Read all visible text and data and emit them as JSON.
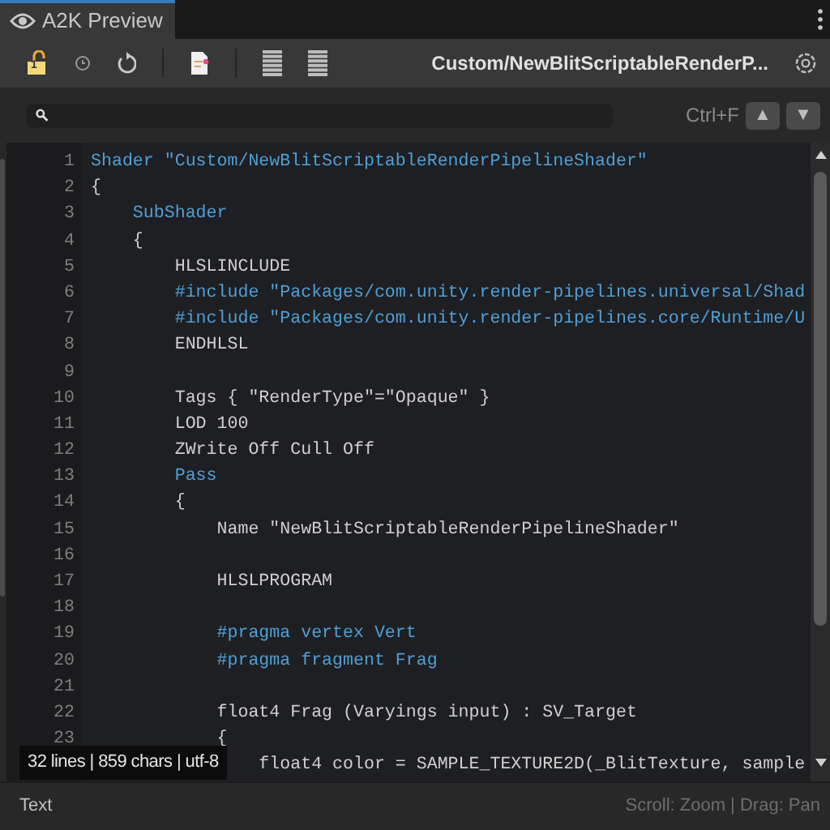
{
  "tab": {
    "label": "A2K Preview",
    "selected": true
  },
  "toolbar": {
    "lock_badge": "1",
    "title": "Custom/NewBlitScriptableRenderP..."
  },
  "search": {
    "shortcut": "Ctrl+F",
    "prev": "▲",
    "next": "▼"
  },
  "code": {
    "lines": [
      {
        "number": "1",
        "kind": "keyword",
        "text": "Shader \"Custom/NewBlitScriptableRenderPipelineShader\""
      },
      {
        "number": "2",
        "kind": "plain",
        "text": "{"
      },
      {
        "number": "3",
        "kind": "keyword",
        "text": "    SubShader"
      },
      {
        "number": "4",
        "kind": "plain",
        "text": "    {"
      },
      {
        "number": "5",
        "kind": "plain",
        "text": "        HLSLINCLUDE"
      },
      {
        "number": "6",
        "kind": "keyword",
        "text": "        #include \"Packages/com.unity.render-pipelines.universal/Shad"
      },
      {
        "number": "7",
        "kind": "keyword",
        "text": "        #include \"Packages/com.unity.render-pipelines.core/Runtime/U"
      },
      {
        "number": "8",
        "kind": "plain",
        "text": "        ENDHLSL"
      },
      {
        "number": "9",
        "kind": "plain"
      },
      {
        "number": "10",
        "kind": "plain",
        "text": "        Tags { \"RenderType\"=\"Opaque\" }"
      },
      {
        "number": "11",
        "kind": "plain",
        "text": "        LOD 100"
      },
      {
        "number": "12",
        "kind": "plain",
        "text": "        ZWrite Off Cull Off"
      },
      {
        "number": "13",
        "kind": "keyword",
        "text": "        Pass"
      },
      {
        "number": "14",
        "kind": "plain",
        "text": "        {"
      },
      {
        "number": "15",
        "kind": "plain",
        "text": "            Name \"NewBlitScriptableRenderPipelineShader\""
      },
      {
        "number": "16",
        "kind": "plain"
      },
      {
        "number": "17",
        "kind": "plain",
        "text": "            HLSLPROGRAM"
      },
      {
        "number": "18",
        "kind": "plain"
      },
      {
        "number": "19",
        "kind": "keyword",
        "text": "            #pragma vertex Vert"
      },
      {
        "number": "20",
        "kind": "keyword",
        "text": "            #pragma fragment Frag"
      },
      {
        "number": "21",
        "kind": "plain"
      },
      {
        "number": "22",
        "kind": "plain",
        "text": "            float4 Frag (Varyings input) : SV_Target"
      },
      {
        "number": "23",
        "kind": "plain",
        "text": "            {"
      },
      {
        "kind": "plain",
        "text": "                float4 color = SAMPLE_TEXTURE2D(_BlitTexture, sample"
      }
    ]
  },
  "overlay": "32 lines | 859 chars | utf-8",
  "footer": {
    "label": "Text",
    "hint": "Scroll: Zoom | Drag: Pan"
  }
}
